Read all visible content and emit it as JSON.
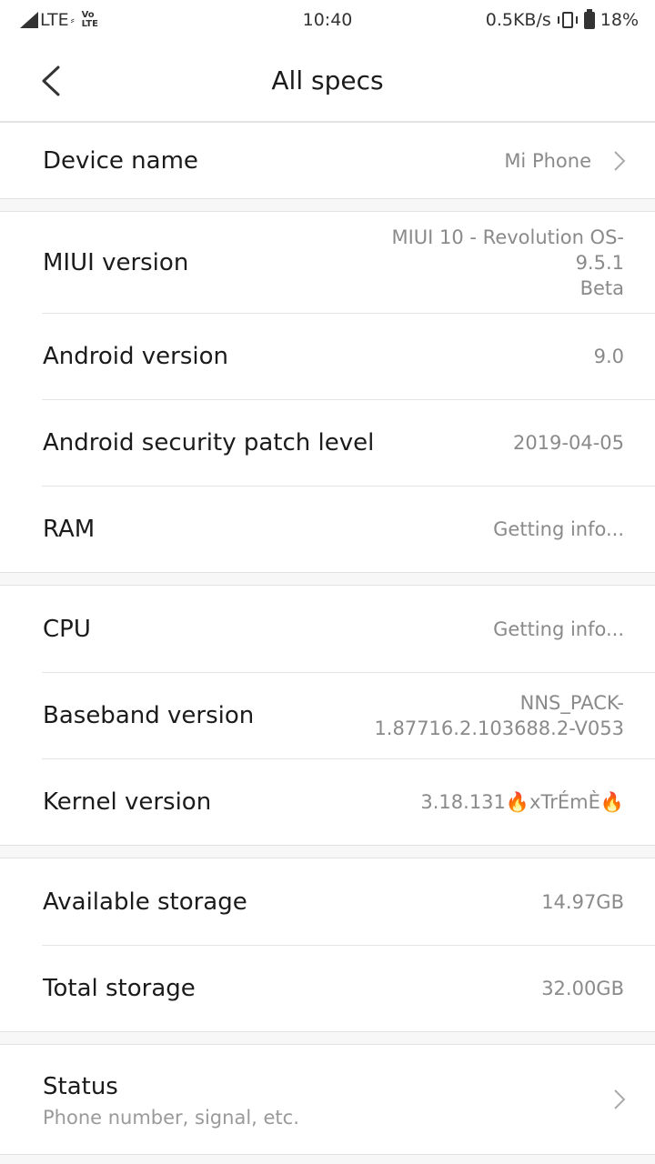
{
  "status_bar": {
    "network": "LTE",
    "volte_top": "Vo",
    "volte_bottom": "LTE",
    "time": "10:40",
    "speed": "0.5KB/s",
    "battery": "18%"
  },
  "header": {
    "title": "All specs"
  },
  "sections": [
    {
      "rows": [
        {
          "label": "Device name",
          "value": "Mi Phone"
        }
      ]
    },
    {
      "rows": [
        {
          "label": "MIUI version",
          "value_lines": [
            "MIUI 10 - Revolution OS-",
            "9.5.1",
            "Beta"
          ]
        },
        {
          "label": "Android version",
          "value": "9.0"
        },
        {
          "label": "Android security patch level",
          "value": "2019-04-05"
        },
        {
          "label": "RAM",
          "value": "Getting info..."
        }
      ]
    },
    {
      "rows": [
        {
          "label": "CPU",
          "value": "Getting info..."
        },
        {
          "label": "Baseband version",
          "value_lines": [
            "NNS_PACK-",
            "1.87716.2.103688.2-V053"
          ]
        },
        {
          "label": "Kernel version",
          "value": "3.18.131🔥xTrÉmÈ🔥"
        }
      ]
    },
    {
      "rows": [
        {
          "label": "Available storage",
          "value": "14.97GB"
        },
        {
          "label": "Total storage",
          "value": "32.00GB"
        }
      ]
    },
    {
      "rows": [
        {
          "label": "Status",
          "sublabel": "Phone number, signal, etc."
        }
      ]
    }
  ]
}
